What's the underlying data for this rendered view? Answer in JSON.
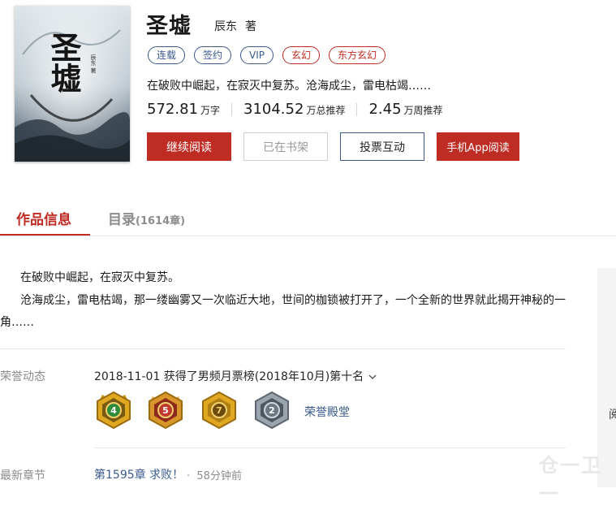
{
  "book": {
    "title": "圣墟",
    "author": "辰东",
    "author_suffix": "著",
    "tags": [
      {
        "label": "连载",
        "style": "blue"
      },
      {
        "label": "签约",
        "style": "blue"
      },
      {
        "label": "VIP",
        "style": "blue"
      },
      {
        "label": "玄幻",
        "style": "red"
      },
      {
        "label": "东方玄幻",
        "style": "red"
      }
    ],
    "intro": "在破败中崛起，在寂灭中复苏。沧海成尘，雷电枯竭……",
    "stats": [
      {
        "value": "572.81",
        "unit": "万字"
      },
      {
        "value": "3104.52",
        "unit": "万总推荐"
      },
      {
        "value": "2.45",
        "unit": "万周推荐"
      }
    ],
    "cover": {
      "title_art": "圣墟",
      "small_text": "辰东 著"
    }
  },
  "buttons": {
    "continue_reading": "继续阅读",
    "on_shelf": "已在书架",
    "vote": "投票互动",
    "app_read": "手机App阅读"
  },
  "tabs": {
    "info": "作品信息",
    "toc": "目录",
    "toc_count": "(1614章)"
  },
  "description": {
    "line1": "在破败中崛起，在寂灭中复苏。",
    "line2": "沧海成尘，雷电枯竭，那一缕幽雾又一次临近大地，世间的枷锁被打开了，一个全新的世界就此揭开神秘的一",
    "line3": "角……"
  },
  "honor": {
    "label": "荣誉动态",
    "text": "2018-11-01  获得了男频月票榜(2018年10月)第十名",
    "badges": [
      {
        "icon": "badge-4-icon",
        "number": "4",
        "color": "#d4a017"
      },
      {
        "icon": "badge-5-icon",
        "number": "5",
        "color": "#c0392b"
      },
      {
        "icon": "badge-7-icon",
        "number": "7",
        "color": "#d4a017"
      },
      {
        "icon": "badge-2-icon",
        "number": "2",
        "color": "#7f8c9a"
      }
    ],
    "hall_link": "荣誉殿堂"
  },
  "latest": {
    "label": "最新章节",
    "chapter": "第1595章 求败！",
    "dot": "·",
    "time": "58分钟前"
  },
  "sidebar": {
    "char": "阅"
  },
  "watermark": "仓一卫一",
  "colors": {
    "accent_red": "#bf2c24",
    "link_blue": "#3a5a8c",
    "muted": "#8c8c8c"
  }
}
